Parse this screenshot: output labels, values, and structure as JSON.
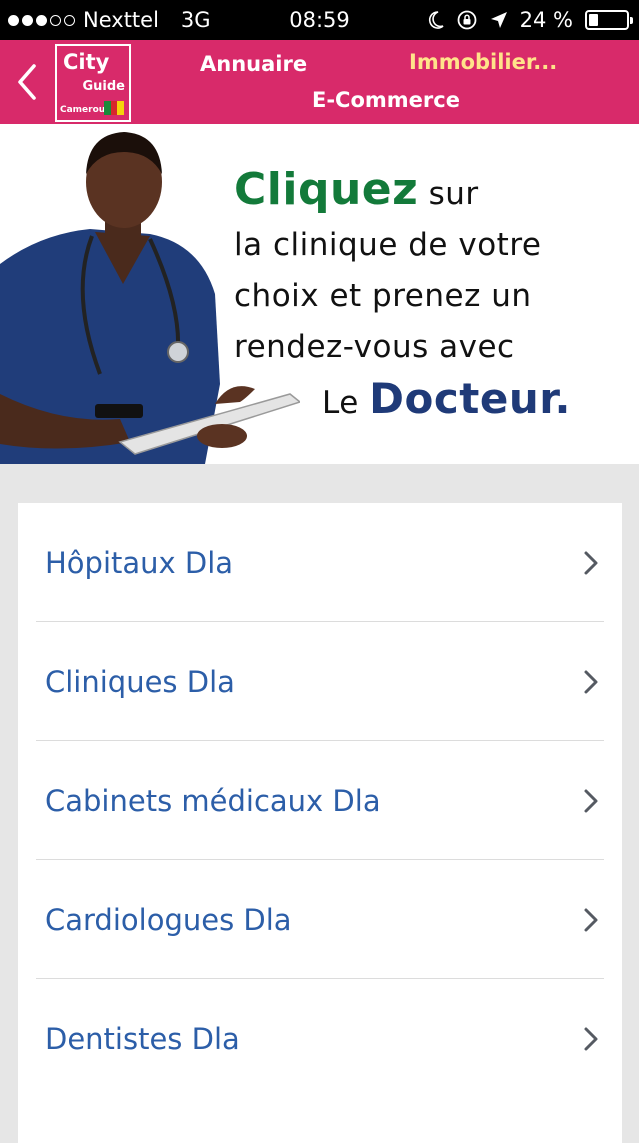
{
  "status_bar": {
    "signal_dots_filled": 3,
    "signal_dots_total": 5,
    "carrier": "Nexttel",
    "network": "3G",
    "time": "08:59",
    "battery_text": "24 %",
    "battery_level": 0.24,
    "icons": [
      "moon-icon",
      "rotation-lock-icon",
      "location-arrow-icon",
      "battery-icon"
    ]
  },
  "nav": {
    "back_icon": "chevron-left-icon",
    "logo": {
      "city": "City",
      "guide": "Guide",
      "country": "Cameroun"
    },
    "links": {
      "annuaire": "Annuaire",
      "immobilier": "Immobilier...",
      "ecommerce": "E-Commerce"
    },
    "colors": {
      "bar": "#d82a6a",
      "active_link": "#ffe38a"
    }
  },
  "banner": {
    "cliquez": "Cliquez",
    "line1_rest": " sur",
    "line2": "la clinique de votre",
    "line3": "choix et prenez un",
    "line4": "rendez-vous avec",
    "le": "Le ",
    "docteur": "Docteur",
    "period": ".",
    "image": "doctor-with-clipboard-image"
  },
  "list": {
    "items": [
      {
        "label": "Hôpitaux Dla"
      },
      {
        "label": "Cliniques Dla"
      },
      {
        "label": "Cabinets médicaux Dla"
      },
      {
        "label": "Cardiologues Dla"
      },
      {
        "label": "Dentistes Dla"
      }
    ],
    "chevron_icon": "chevron-right-icon",
    "label_color": "#2c5ea8"
  }
}
